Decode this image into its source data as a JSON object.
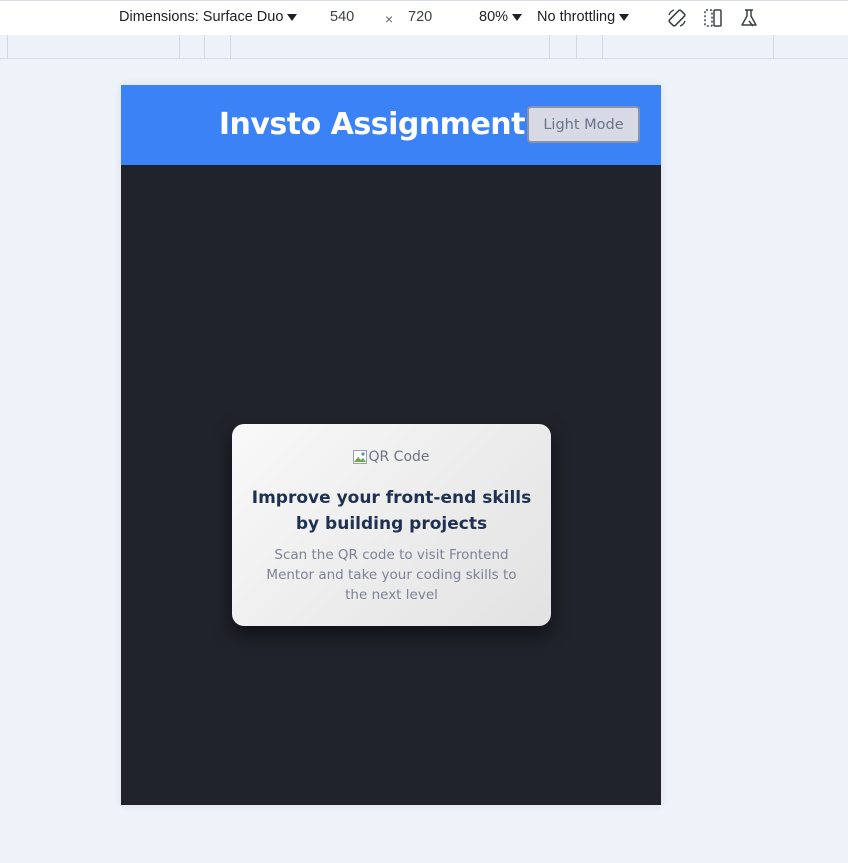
{
  "devtools": {
    "dimensions_label": "Dimensions: Surface Duo",
    "width": "540",
    "times": "×",
    "height": "720",
    "zoom": "80%",
    "throttling": "No throttling",
    "icons": [
      "rotate-icon",
      "dual-screen-icon",
      "sensors-icon"
    ]
  },
  "app": {
    "title": "Invsto Assignment",
    "mode_button": "Light Mode",
    "header_color": "#3b82f6",
    "background_color": "#20232b"
  },
  "card": {
    "image_alt": "QR Code",
    "heading": "Improve your front-end skills by building projects",
    "text": "Scan the QR code to visit Frontend Mentor and take your coding skills to the next level"
  }
}
